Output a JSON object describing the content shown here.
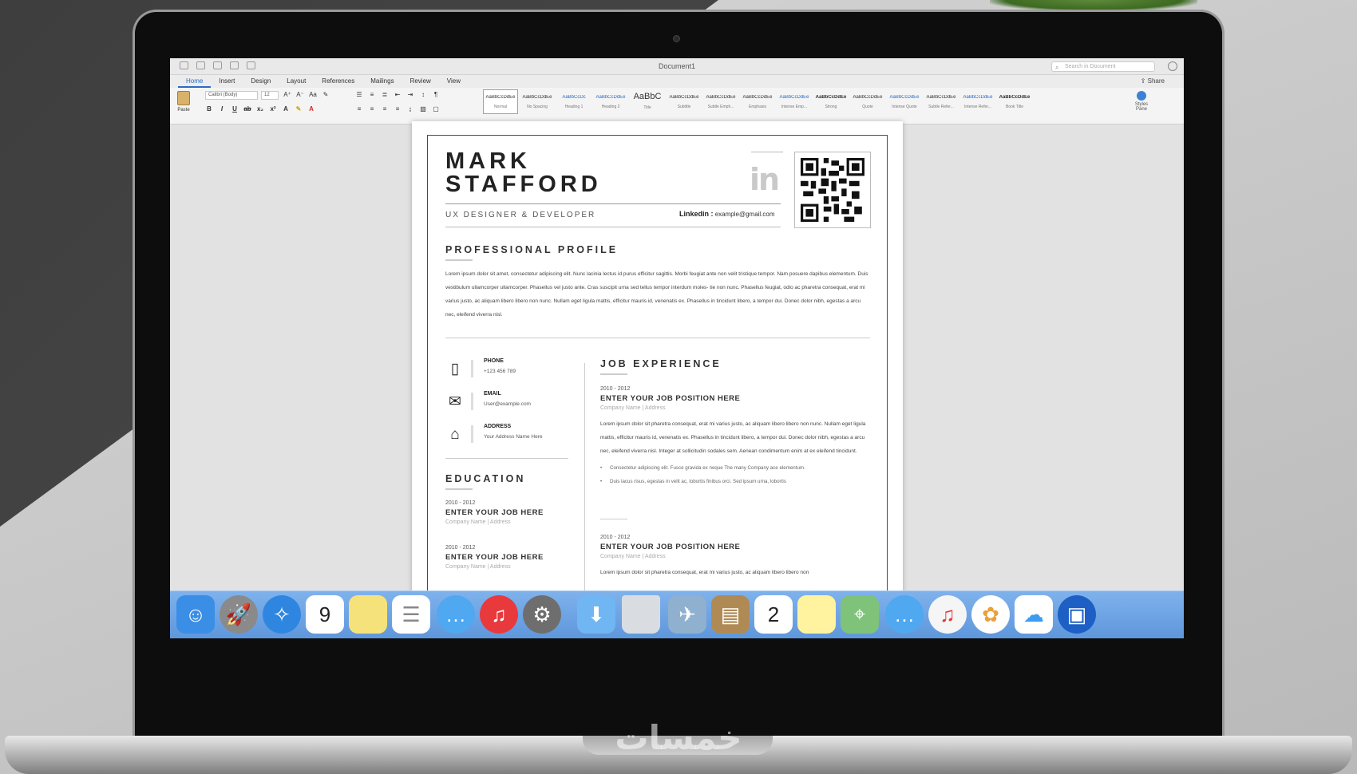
{
  "window": {
    "title": "Document1",
    "search_placeholder": "Search in Document",
    "share_label": "Share"
  },
  "tabs": [
    "Home",
    "Insert",
    "Design",
    "Layout",
    "References",
    "Mailings",
    "Review",
    "View"
  ],
  "ribbon": {
    "paste_label": "Paste",
    "font_name": "Calibri (Body)",
    "font_size": "12",
    "styles": [
      {
        "sample": "AaBbCcDdEe",
        "name": "Normal"
      },
      {
        "sample": "AaBbCcDdEe",
        "name": "No Spacing"
      },
      {
        "sample": "AaBbCcDc",
        "name": "Heading 1"
      },
      {
        "sample": "AaBbCcDdEe",
        "name": "Heading 2"
      },
      {
        "sample": "AaBbC",
        "name": "Title"
      },
      {
        "sample": "AaBbCcDdEe",
        "name": "Subtitle"
      },
      {
        "sample": "AaBbCcDdEe",
        "name": "Subtle Emph..."
      },
      {
        "sample": "AaBbCcDdEe",
        "name": "Emphasis"
      },
      {
        "sample": "AaBbCcDdEe",
        "name": "Intense Emp..."
      },
      {
        "sample": "AaBbCcDdEe",
        "name": "Strong"
      },
      {
        "sample": "AaBbCcDdEe",
        "name": "Quote"
      },
      {
        "sample": "AaBbCcDdEe",
        "name": "Intense Quote"
      },
      {
        "sample": "AaBbCcDdEe",
        "name": "Subtle Refer..."
      },
      {
        "sample": "AaBbCcDdEe",
        "name": "Intense Refer..."
      },
      {
        "sample": "AaBbCcDdEe",
        "name": "Book Title"
      }
    ],
    "styles_pane_label": "Styles Pane"
  },
  "resume": {
    "first_name": "MARK",
    "last_name": "STAFFORD",
    "role": "UX DESIGNER & DEVELOPER",
    "linkedin_label": "Linkedin :",
    "linkedin_value": "example@gmail.com",
    "linkedin_logo": "in",
    "profile_title": "PROFESSIONAL PROFILE",
    "profile_text": "Lorem ipsum dolor sit amet, consectetur adipiscing elit. Nunc lacinia lectus id purus efficitur sagittis. Morbi feugiat ante non velit tristique tempor. Nam posuere dapibus elementum. Duis vestibulum ullamcorper ullamcorper. Phasellus vel justo ante. Cras suscipit urna sed tellus tempor interdum moles- tie non nunc. Phasellus feugiat, odio ac pharetra consequat, erat mi varius justo, ac aliquam libero libero non nunc. Nullam eget ligula mattis, efficitur mauris id, venenatis ex. Phasellus in tincidunt libero, a tempor dui. Donec dolor nibh, egestas a arcu nec, eleifend viverra nisl.",
    "contacts": [
      {
        "icon": "phone-icon",
        "glyph": "▯",
        "label": "PHONE",
        "value": "+123 456 789"
      },
      {
        "icon": "email-icon",
        "glyph": "✉",
        "label": "EMAIL",
        "value": "User@example.com"
      },
      {
        "icon": "home-icon",
        "glyph": "⌂",
        "label": "ADDRESS",
        "value": "Your Address Name Here"
      }
    ],
    "education_title": "EDUCATION",
    "education": [
      {
        "period": "2010 - 2012",
        "position": "ENTER YOUR JOB HERE",
        "company": "Company Name  |  Address"
      },
      {
        "period": "2010 - 2012",
        "position": "ENTER YOUR JOB HERE",
        "company": "Company Name  |  Address"
      }
    ],
    "job_title": "JOB EXPERIENCE",
    "jobs": [
      {
        "period": "2010 - 2012",
        "position": "ENTER YOUR JOB POSITION HERE",
        "company": "Company Name  |  Address",
        "text": "Lorem ipsum dolor sit pharetra consequat, erat mi varius justo, ac aliquam libero libero non nunc. Nullam eget ligula mattis, efficitur mauris id, venenatis ex. Phasellus in tincidunt libero, a tempor dui. Donec dolor nibh, egestas a arcu nec, eleifend viverra nisl. Integer at sollicitudin sodales sem. Aenean condimentum enim at ex eleifend tincidunt.",
        "bullets": [
          "Consectetur adipiscing elit. Fusce gravida ex neque The many Company ace elementum.",
          "Duis lacus risus, egestas in velit ac, lobortis finibus orci. Sed ipsum urna, lobortis"
        ]
      },
      {
        "period": "2010 - 2012",
        "position": "ENTER YOUR JOB POSITION HERE",
        "company": "Company Name  |  Address",
        "text": "Lorem ipsum dolor sit pharetra consequat, erat mi varius justo, ac aliquam libero libero non",
        "bullets": []
      }
    ]
  },
  "dock": [
    {
      "name": "finder-icon",
      "glyph": "☺",
      "color": "#3a8ee6"
    },
    {
      "name": "launchpad-icon",
      "glyph": "🚀",
      "color": "#8a8a8a"
    },
    {
      "name": "safari-icon",
      "glyph": "✧",
      "color": "#2f86e0"
    },
    {
      "name": "calendar-icon",
      "glyph": "9",
      "color": "#ffffff"
    },
    {
      "name": "notes-icon",
      "glyph": "",
      "color": "#f6e27a"
    },
    {
      "name": "reminders-icon",
      "glyph": "☰",
      "color": "#ffffff"
    },
    {
      "name": "messages-icon",
      "glyph": "…",
      "color": "#4fa8f0"
    },
    {
      "name": "itunes-icon",
      "glyph": "♫",
      "color": "#e8393d"
    },
    {
      "name": "system-preferences-icon",
      "glyph": "⚙",
      "color": "#6e6e6e"
    },
    {
      "name": "downloads-folder-icon",
      "glyph": "⬇",
      "color": "#6fb6f2"
    },
    {
      "name": "trash-icon",
      "glyph": "",
      "color": "#d9dde2"
    },
    {
      "name": "preview-icon",
      "glyph": "✈",
      "color": "#8fb0cf"
    },
    {
      "name": "contacts-icon",
      "glyph": "▤",
      "color": "#b08a55"
    },
    {
      "name": "calendar-icon-2",
      "glyph": "2",
      "color": "#ffffff"
    },
    {
      "name": "stickies-icon",
      "glyph": "",
      "color": "#fff3a0"
    },
    {
      "name": "maps-icon",
      "glyph": "⌖",
      "color": "#7fc27a"
    },
    {
      "name": "messages-icon-2",
      "glyph": "…",
      "color": "#4fa8f0"
    },
    {
      "name": "music-icon",
      "glyph": "♫",
      "color": "#f5f5f5"
    },
    {
      "name": "photos-icon",
      "glyph": "✿",
      "color": "#ffffff"
    },
    {
      "name": "icloud-icon",
      "glyph": "☁",
      "color": "#3b9cf0"
    },
    {
      "name": "video-icon",
      "glyph": "▣",
      "color": "#1d5fc4"
    }
  ],
  "watermark": "خمسات"
}
